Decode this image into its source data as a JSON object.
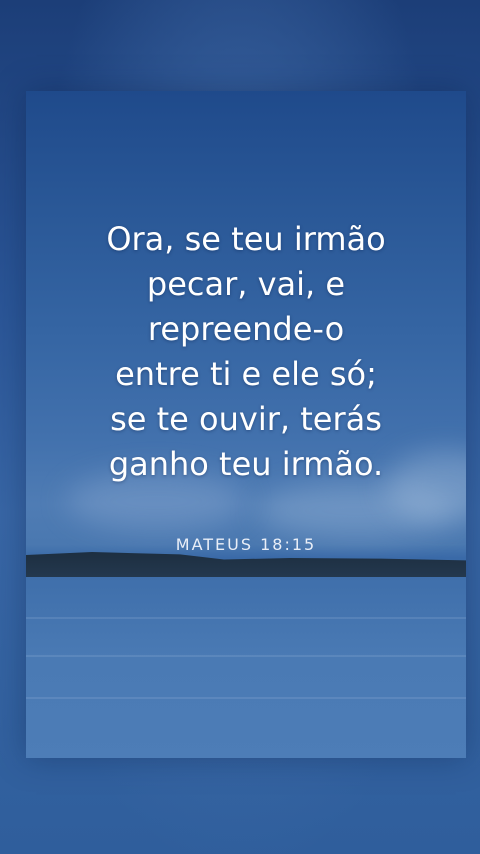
{
  "verse": {
    "lines": [
      "Ora, se teu irmão",
      "pecar, vai, e",
      "repreende-o",
      "entre ti e ele só;",
      "se te ouvir, terás",
      "ganho teu irmão."
    ],
    "reference": "MATEUS 18:15"
  },
  "colors": {
    "sky_top": "#1f4a8b",
    "sky_mid": "#4271ad",
    "water": "#4a7ab4",
    "land": "#1c2d3f",
    "text": "#ffffff"
  }
}
